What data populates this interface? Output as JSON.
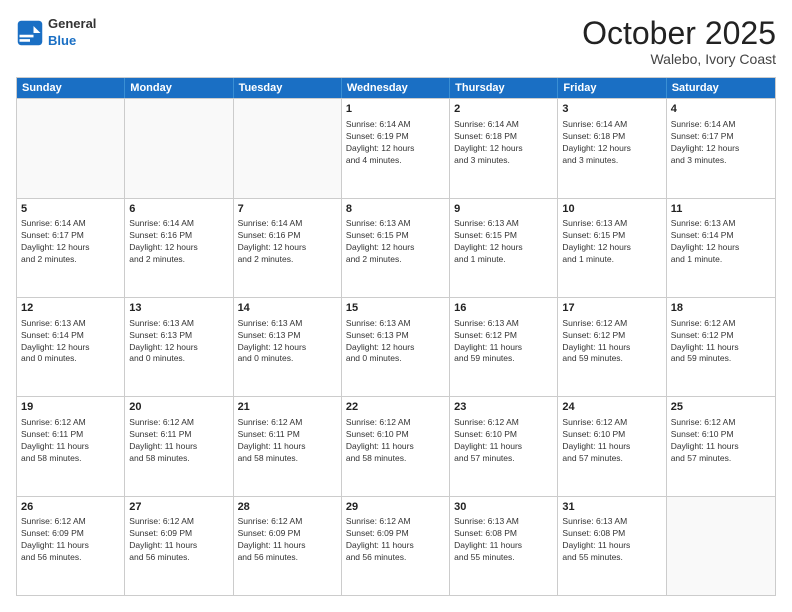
{
  "logo": {
    "general": "General",
    "blue": "Blue"
  },
  "header": {
    "month": "October 2025",
    "location": "Walebo, Ivory Coast"
  },
  "weekdays": [
    "Sunday",
    "Monday",
    "Tuesday",
    "Wednesday",
    "Thursday",
    "Friday",
    "Saturday"
  ],
  "weeks": [
    [
      {
        "day": "",
        "info": ""
      },
      {
        "day": "",
        "info": ""
      },
      {
        "day": "",
        "info": ""
      },
      {
        "day": "1",
        "info": "Sunrise: 6:14 AM\nSunset: 6:19 PM\nDaylight: 12 hours\nand 4 minutes."
      },
      {
        "day": "2",
        "info": "Sunrise: 6:14 AM\nSunset: 6:18 PM\nDaylight: 12 hours\nand 3 minutes."
      },
      {
        "day": "3",
        "info": "Sunrise: 6:14 AM\nSunset: 6:18 PM\nDaylight: 12 hours\nand 3 minutes."
      },
      {
        "day": "4",
        "info": "Sunrise: 6:14 AM\nSunset: 6:17 PM\nDaylight: 12 hours\nand 3 minutes."
      }
    ],
    [
      {
        "day": "5",
        "info": "Sunrise: 6:14 AM\nSunset: 6:17 PM\nDaylight: 12 hours\nand 2 minutes."
      },
      {
        "day": "6",
        "info": "Sunrise: 6:14 AM\nSunset: 6:16 PM\nDaylight: 12 hours\nand 2 minutes."
      },
      {
        "day": "7",
        "info": "Sunrise: 6:14 AM\nSunset: 6:16 PM\nDaylight: 12 hours\nand 2 minutes."
      },
      {
        "day": "8",
        "info": "Sunrise: 6:13 AM\nSunset: 6:15 PM\nDaylight: 12 hours\nand 2 minutes."
      },
      {
        "day": "9",
        "info": "Sunrise: 6:13 AM\nSunset: 6:15 PM\nDaylight: 12 hours\nand 1 minute."
      },
      {
        "day": "10",
        "info": "Sunrise: 6:13 AM\nSunset: 6:15 PM\nDaylight: 12 hours\nand 1 minute."
      },
      {
        "day": "11",
        "info": "Sunrise: 6:13 AM\nSunset: 6:14 PM\nDaylight: 12 hours\nand 1 minute."
      }
    ],
    [
      {
        "day": "12",
        "info": "Sunrise: 6:13 AM\nSunset: 6:14 PM\nDaylight: 12 hours\nand 0 minutes."
      },
      {
        "day": "13",
        "info": "Sunrise: 6:13 AM\nSunset: 6:13 PM\nDaylight: 12 hours\nand 0 minutes."
      },
      {
        "day": "14",
        "info": "Sunrise: 6:13 AM\nSunset: 6:13 PM\nDaylight: 12 hours\nand 0 minutes."
      },
      {
        "day": "15",
        "info": "Sunrise: 6:13 AM\nSunset: 6:13 PM\nDaylight: 12 hours\nand 0 minutes."
      },
      {
        "day": "16",
        "info": "Sunrise: 6:13 AM\nSunset: 6:12 PM\nDaylight: 11 hours\nand 59 minutes."
      },
      {
        "day": "17",
        "info": "Sunrise: 6:12 AM\nSunset: 6:12 PM\nDaylight: 11 hours\nand 59 minutes."
      },
      {
        "day": "18",
        "info": "Sunrise: 6:12 AM\nSunset: 6:12 PM\nDaylight: 11 hours\nand 59 minutes."
      }
    ],
    [
      {
        "day": "19",
        "info": "Sunrise: 6:12 AM\nSunset: 6:11 PM\nDaylight: 11 hours\nand 58 minutes."
      },
      {
        "day": "20",
        "info": "Sunrise: 6:12 AM\nSunset: 6:11 PM\nDaylight: 11 hours\nand 58 minutes."
      },
      {
        "day": "21",
        "info": "Sunrise: 6:12 AM\nSunset: 6:11 PM\nDaylight: 11 hours\nand 58 minutes."
      },
      {
        "day": "22",
        "info": "Sunrise: 6:12 AM\nSunset: 6:10 PM\nDaylight: 11 hours\nand 58 minutes."
      },
      {
        "day": "23",
        "info": "Sunrise: 6:12 AM\nSunset: 6:10 PM\nDaylight: 11 hours\nand 57 minutes."
      },
      {
        "day": "24",
        "info": "Sunrise: 6:12 AM\nSunset: 6:10 PM\nDaylight: 11 hours\nand 57 minutes."
      },
      {
        "day": "25",
        "info": "Sunrise: 6:12 AM\nSunset: 6:10 PM\nDaylight: 11 hours\nand 57 minutes."
      }
    ],
    [
      {
        "day": "26",
        "info": "Sunrise: 6:12 AM\nSunset: 6:09 PM\nDaylight: 11 hours\nand 56 minutes."
      },
      {
        "day": "27",
        "info": "Sunrise: 6:12 AM\nSunset: 6:09 PM\nDaylight: 11 hours\nand 56 minutes."
      },
      {
        "day": "28",
        "info": "Sunrise: 6:12 AM\nSunset: 6:09 PM\nDaylight: 11 hours\nand 56 minutes."
      },
      {
        "day": "29",
        "info": "Sunrise: 6:12 AM\nSunset: 6:09 PM\nDaylight: 11 hours\nand 56 minutes."
      },
      {
        "day": "30",
        "info": "Sunrise: 6:13 AM\nSunset: 6:08 PM\nDaylight: 11 hours\nand 55 minutes."
      },
      {
        "day": "31",
        "info": "Sunrise: 6:13 AM\nSunset: 6:08 PM\nDaylight: 11 hours\nand 55 minutes."
      },
      {
        "day": "",
        "info": ""
      }
    ]
  ]
}
